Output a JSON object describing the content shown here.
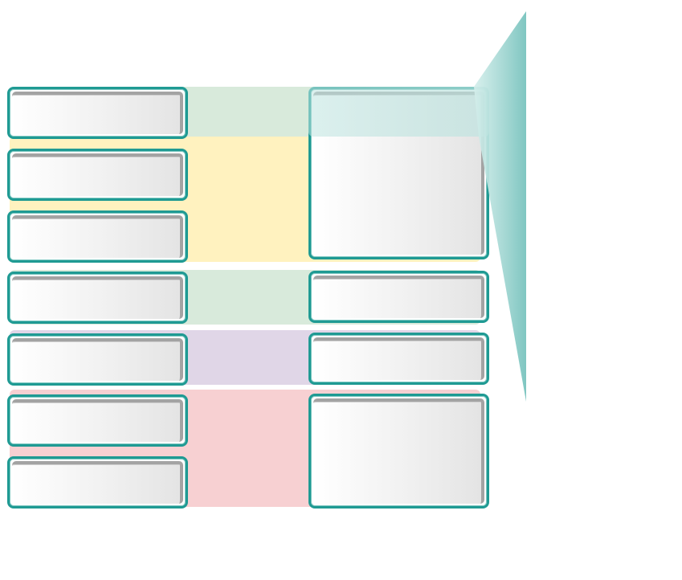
{
  "colors": {
    "box_border": "#1f9a93",
    "band_green": "#d8eadb",
    "band_yellow": "#fff2bf",
    "band_purple": "#e0d6e7",
    "band_pink": "#f7d0d2",
    "callout": "#7fc6c1"
  },
  "bands": [
    {
      "name": "band-green-top",
      "color": "#d8eadb"
    },
    {
      "name": "band-yellow",
      "color": "#fff2bf"
    },
    {
      "name": "band-green-mid",
      "color": "#d8eadb"
    },
    {
      "name": "band-purple",
      "color": "#e0d6e7"
    },
    {
      "name": "band-pink",
      "color": "#f7d0d2"
    }
  ],
  "left_boxes": [
    {
      "label": ""
    },
    {
      "label": ""
    },
    {
      "label": ""
    },
    {
      "label": ""
    },
    {
      "label": ""
    },
    {
      "label": ""
    },
    {
      "label": ""
    }
  ],
  "right_boxes": [
    {
      "label": ""
    },
    {
      "label": ""
    },
    {
      "label": ""
    },
    {
      "label": ""
    }
  ]
}
